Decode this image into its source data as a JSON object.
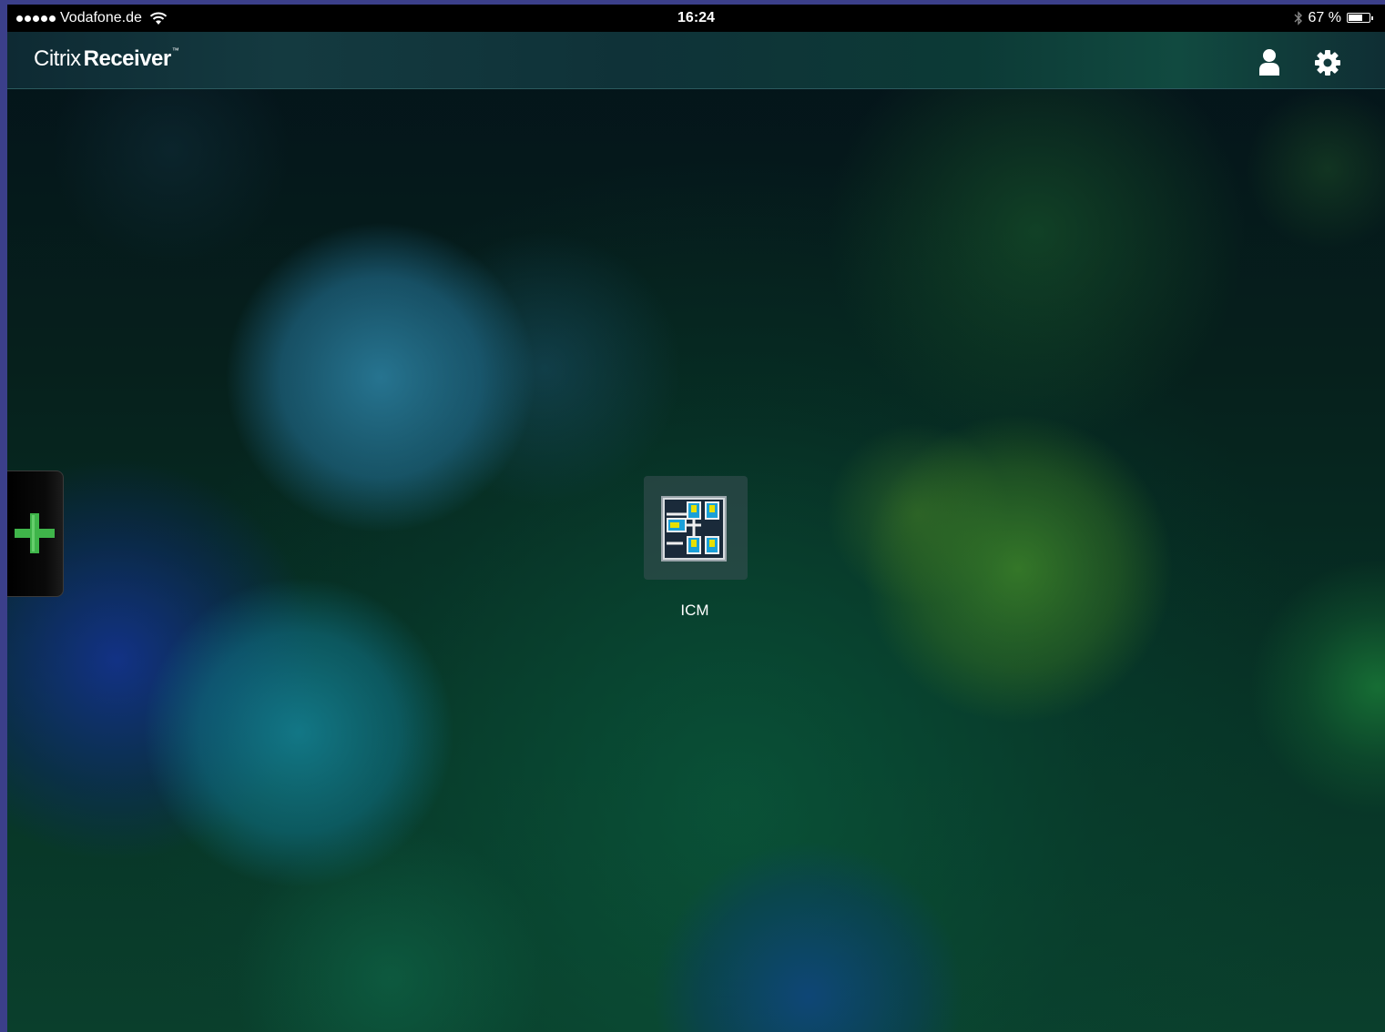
{
  "status_bar": {
    "carrier": "Vodafone.de",
    "time": "16:24",
    "battery_text": "67 %",
    "battery_level": 0.67
  },
  "header": {
    "brand_light": "Citrix",
    "brand_bold": "Receiver",
    "trademark": "™",
    "account_icon": "person-icon",
    "settings_icon": "gear-icon"
  },
  "sidebar": {
    "add_icon": "plus-icon",
    "accent": "#3fb54a"
  },
  "apps": [
    {
      "label": "ICM",
      "icon": "icm-app-icon"
    }
  ],
  "colors": {
    "status_bar_bg": "#000000",
    "header_bg": "#0f3238",
    "add_plus": "#3fb54a"
  }
}
